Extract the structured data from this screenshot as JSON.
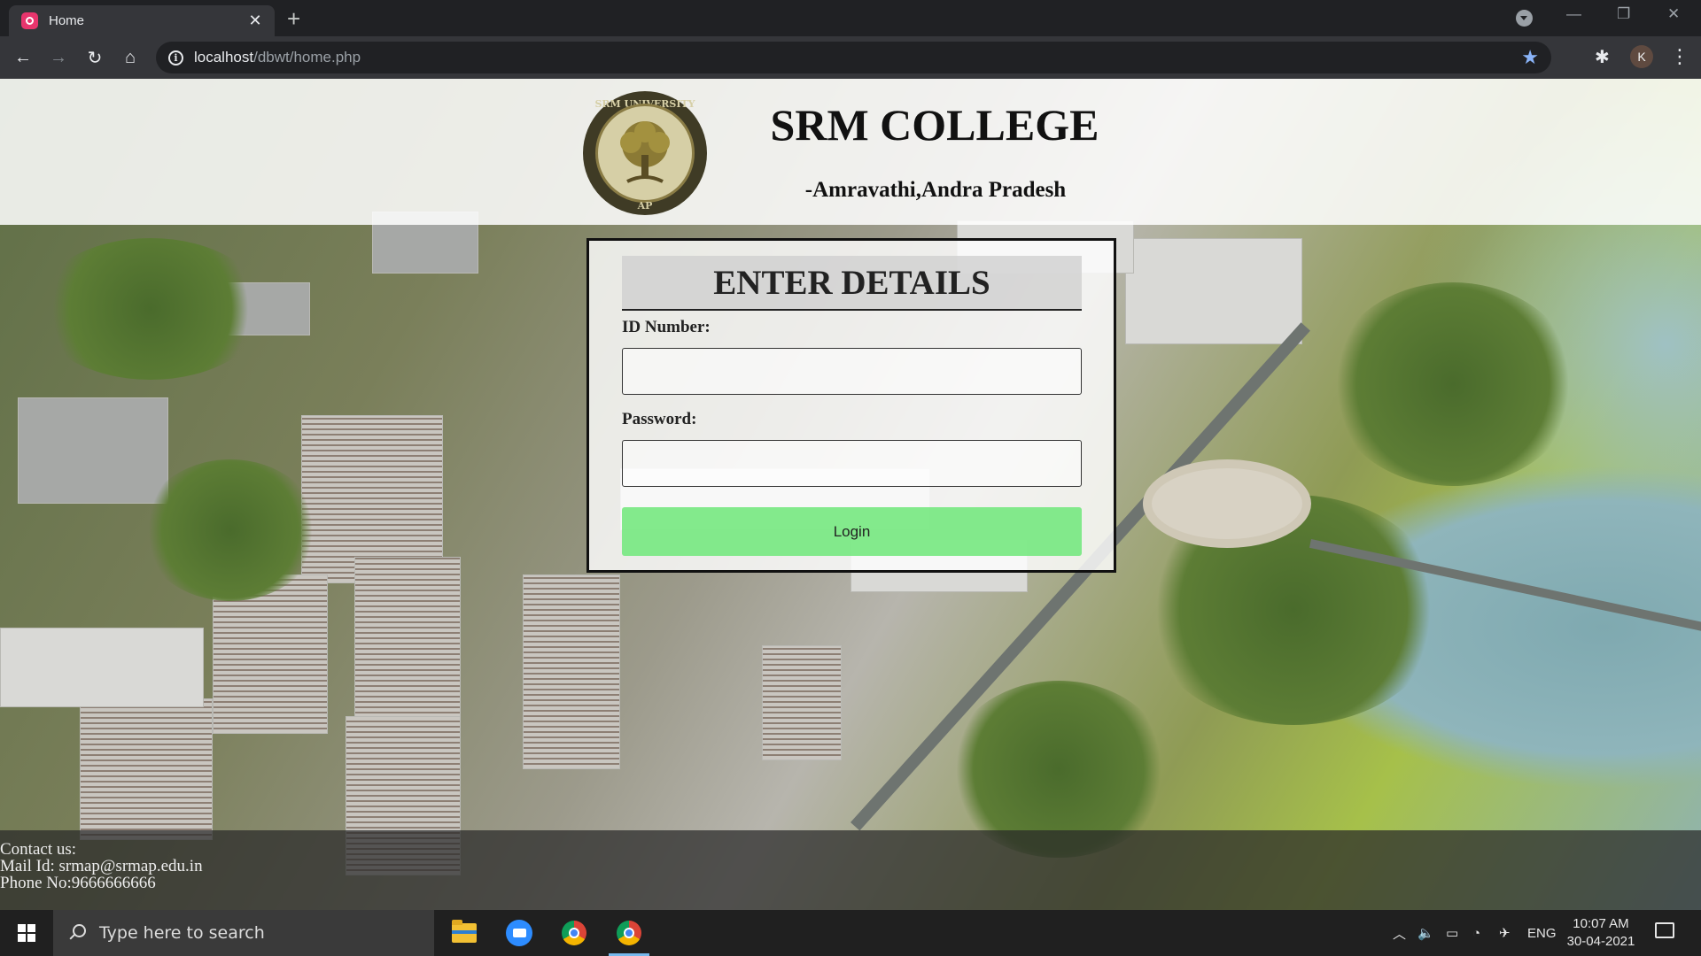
{
  "browser": {
    "tab_title": "Home",
    "tab_close": "✕",
    "new_tab": "+",
    "url_host": "localhost",
    "url_path": "/dbwt/home.php",
    "profile_initial": "K"
  },
  "site": {
    "college_name": "SRM COLLEGE",
    "location": "-Amravathi,Andra Pradesh",
    "logo_ring_top": "SRM UNIVERSITY",
    "logo_ring_bottom": "AP"
  },
  "login": {
    "title": "ENTER DETAILS",
    "id_label": "ID Number:",
    "id_value": "",
    "password_label": "Password:",
    "password_value": "",
    "button_label": "Login"
  },
  "footer": {
    "contact_heading": "Contact us:",
    "mail": "Mail Id: srmap@srmap.edu.in",
    "phone": "Phone No:9666666666"
  },
  "taskbar": {
    "search_placeholder": "Type here to search",
    "language": "ENG",
    "time": "10:07 AM",
    "date": "30-04-2021",
    "apps": [
      "file-explorer",
      "zoom",
      "chrome",
      "chrome"
    ]
  },
  "colors": {
    "login_button": "#78e882",
    "browser_frame": "#202124",
    "taskbar": "#202020"
  }
}
